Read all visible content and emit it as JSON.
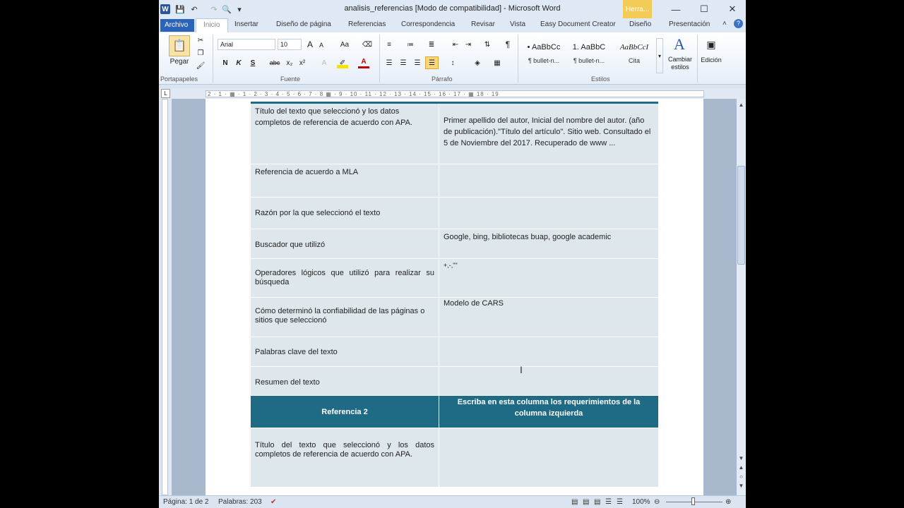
{
  "titlebar": {
    "title": "analisis_referencias [Modo de compatibilidad] - Microsoft Word",
    "context_tab": "Herra...",
    "app_icon": "W"
  },
  "tabs": [
    "Archivo",
    "Inicio",
    "Insertar",
    "Diseño de página",
    "Referencias",
    "Correspondencia",
    "Revisar",
    "Vista",
    "Easy Document Creator",
    "Diseño",
    "Presentación"
  ],
  "ribbon": {
    "clipboard": {
      "paste": "Pegar",
      "label": "Portapapeles"
    },
    "font": {
      "name": "Arial",
      "size": "10",
      "label": "Fuente",
      "bold": "N",
      "italic": "K",
      "underline": "S",
      "strike": "abc",
      "sub": "x₂",
      "sup": "x²",
      "grow": "A",
      "shrink": "A",
      "case": "Aa"
    },
    "paragraph": {
      "label": "Párrafo",
      "pilcrow": "¶"
    },
    "styles": {
      "label": "Estilos",
      "items": [
        {
          "preview": "• AaBbCc",
          "name": "¶ bullet-n..."
        },
        {
          "preview": "1. AaBbC",
          "name": "¶ bullet-n..."
        },
        {
          "preview": "AaBbCcI",
          "name": "Cita"
        }
      ],
      "change": "Cambiar estilos",
      "edit": "Edición"
    }
  },
  "ruler_text": "2 · 1 · ▦ · 1 · 2 · 3 · 4 · 5 · 6 · 7 · 8 ▦ · 9 · 10 · 11 · 12 · 13 · 14 · 15 · 16 · 17 · ▦ 18 · 19",
  "table": {
    "rows": [
      {
        "left": "Título del texto que seleccionó y los datos completos de referencia de acuerdo con APA.",
        "right": "Primer apellido del autor, Inicial del nombre del autor. (año de publicación).\"Título del artículo\". Sitio web. Consultado el 5 de Noviembre del 2017. Recuperado de www ..."
      },
      {
        "left": "Referencia de acuerdo a MLA",
        "right": ""
      },
      {
        "left": "Razón por la que seleccionó el texto",
        "right": ""
      },
      {
        "left": "Buscador que utilizó",
        "right": "Google, bing, bibliotecas buap, google academic"
      },
      {
        "left": "Operadores lógicos que utilizó para realizar su búsqueda",
        "right": "+,-,\"\""
      },
      {
        "left": "Cómo determinó la confiabilidad de las páginas o sitios que seleccionó",
        "right": "Modelo de CARS"
      },
      {
        "left": "Palabras clave del texto",
        "right": ""
      },
      {
        "left": "Resumen del texto",
        "right": ""
      }
    ],
    "header2": {
      "left": "Referencia 2",
      "right": "Escriba en esta columna los requerimientos de la columna izquierda"
    },
    "last_row": {
      "left": "Título del texto que seleccionó y los datos completos de referencia de acuerdo con APA.",
      "right": ""
    }
  },
  "status": {
    "page": "Página: 1 de 2",
    "words": "Palabras: 203",
    "zoom": "100%"
  }
}
